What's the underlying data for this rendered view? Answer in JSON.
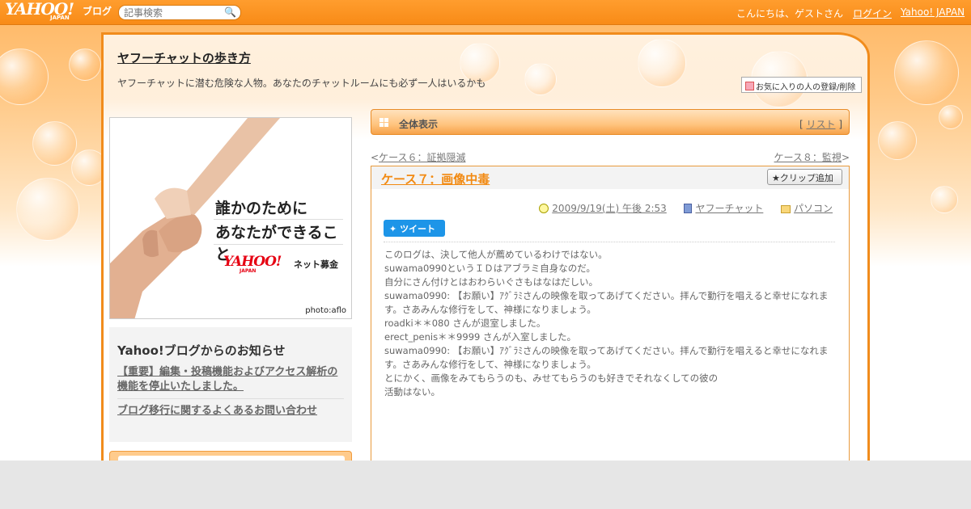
{
  "header": {
    "logo_text": "YAHOO!",
    "logo_sub": "JAPAN",
    "logo_blog": "ブログ",
    "search_placeholder": "記事検索",
    "greeting": "こんにちは、ゲストさん",
    "login": "ログイン",
    "yahoo_japan": "Yahoo! JAPAN"
  },
  "blog": {
    "title": "ヤフーチャットの歩き方",
    "description": "ヤフーチャットに潜む危険な人物。あなたのチャットルームにも必ず一人はいるかも",
    "favorite_button": "お気に入りの人の登録/削除"
  },
  "banner": {
    "line1": "誰かのために",
    "line2": "あなたができること",
    "brand": "YAHOO!",
    "brand_sub": "JAPAN",
    "service": "ネット募金",
    "credit": "photo:aflo"
  },
  "notice": {
    "title": "Yahoo!ブログからのお知らせ",
    "links": [
      "【重要】編集・投稿機能およびアクセス解析の機能を停止いたしました。",
      "ブログ移行に関するよくあるお問い合わせ"
    ]
  },
  "viewbar": {
    "label": "全体表示",
    "list_link": "リスト"
  },
  "navigation": {
    "prev": "ケース６：証拠隠滅",
    "next": "ケース８：監視"
  },
  "entry": {
    "title": "ケース７：画像中毒",
    "clip_button": "クリップ追加",
    "date": "2009/9/19(土) 午後 2:53",
    "author": "ヤフーチャット",
    "category": "パソコン",
    "tweet_button": "ツイート",
    "body": [
      "このログは、決して他人が薦めているわけではない。",
      "",
      "suwama0990というＩＤはアブラミ自身なのだ。",
      "自分にさん付けとはおわらいぐさもはなはだしい。",
      "",
      "suwama0990: 【お願い】ｱｸﾞﾗﾐさんの映像を取ってあげてください。拝んで勤行を唱えると幸せになれます。さあみんな修行をして、神様になりましょう。",
      "roadki＊＊080 さんが退室しました。",
      "erect_penis＊＊9999 さんが入室しました。",
      "suwama0990: 【お願い】ｱｸﾞﾗﾐさんの映像を取ってあげてください。拝んで勤行を唱えると幸せになれます。さあみんな修行をして、神様になりましょう。",
      "",
      "とにかく、画像をみてもらうのも、みせてもらうのも好きでそれなくしての彼の",
      "活動はない。"
    ]
  },
  "colors": {
    "accent": "#f28a12",
    "topbar": "#f88b17",
    "tweet": "#1d95e8"
  }
}
